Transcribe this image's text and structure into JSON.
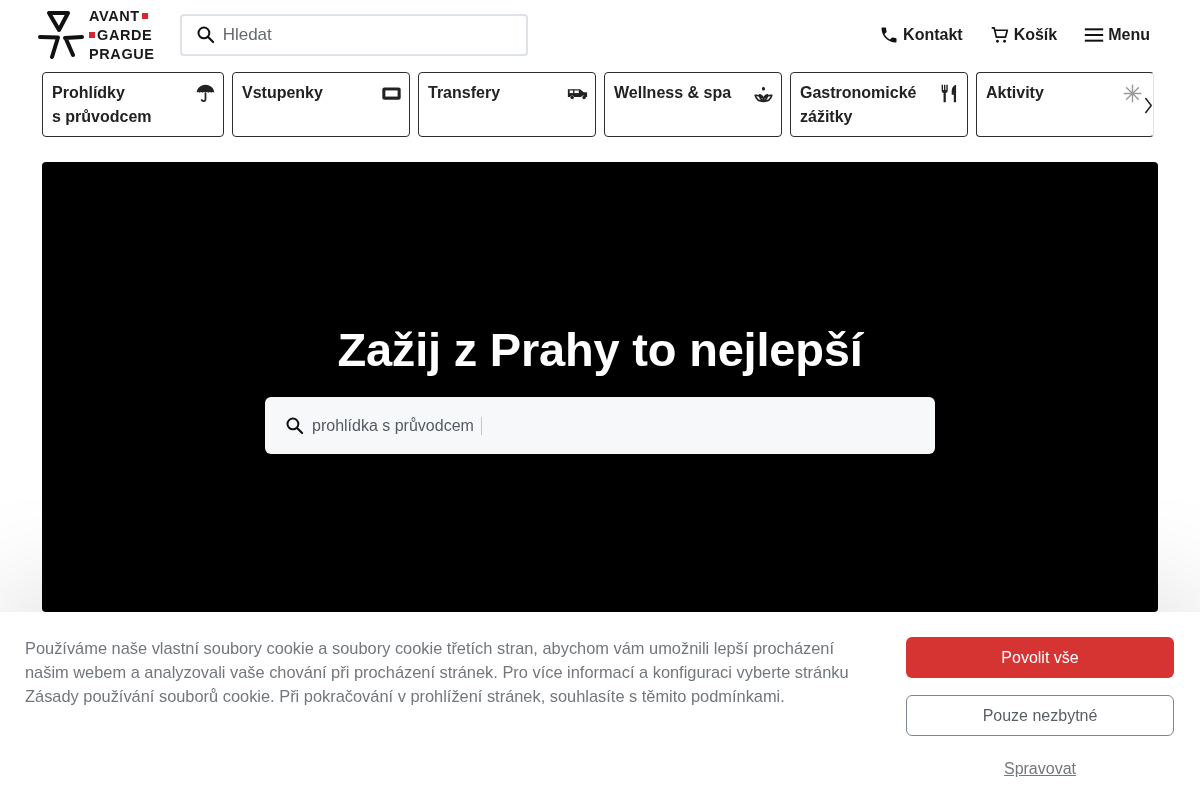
{
  "header": {
    "logo": {
      "lines": [
        {
          "text": "AVANT",
          "square_before": false,
          "square_after": true
        },
        {
          "text": "GARDE",
          "square_before": true,
          "square_after": false
        },
        {
          "text": "PRAGUE",
          "square_before": false,
          "square_after": false
        }
      ]
    },
    "search": {
      "placeholder": "Hledat"
    },
    "nav": [
      {
        "label": "Kontakt"
      },
      {
        "label": "Košík"
      },
      {
        "label": "Menu"
      }
    ]
  },
  "categories": [
    {
      "label": "Prohlídky s průvodcem"
    },
    {
      "label": "Vstupenky"
    },
    {
      "label": "Transfery"
    },
    {
      "label": "Wellness & spa"
    },
    {
      "label": "Gastronomické zážitky"
    },
    {
      "label": "Aktivity"
    }
  ],
  "hero": {
    "title": "Zažij z Prahy to nejlepší",
    "search": {
      "value": "prohlídka s průvodcem"
    }
  },
  "cookie_banner": {
    "text": "Používáme naše vlastní soubory cookie a soubory cookie třetích stran, abychom vám umožnili lepší procházení našim webem a analyzovali vaše chování při procházení stránek. Pro více informací a konfiguraci vyberte stránku Zásady používání souborů cookie. Při pokračování v prohlížení stránek, souhlasíte s těmito podmínkami.",
    "buttons": [
      {
        "label": "Povolit vše",
        "kind": "primary"
      },
      {
        "label": "Pouze nezbytné",
        "kind": "secondary"
      },
      {
        "label": "Spravovat",
        "kind": "link"
      }
    ]
  }
}
